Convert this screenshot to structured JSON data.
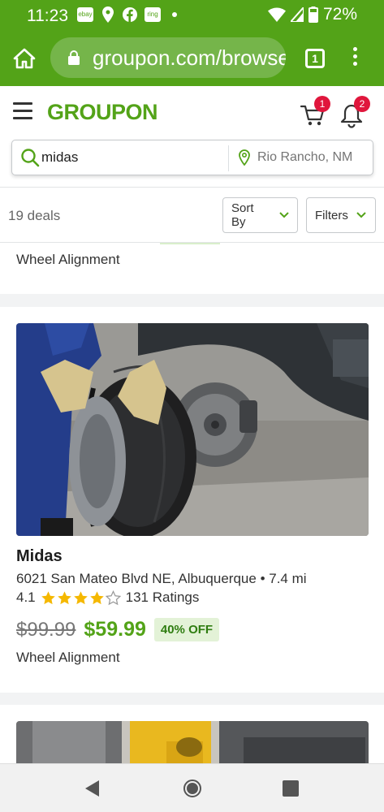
{
  "status_bar": {
    "time": "11:23",
    "notif_icons": [
      "ebay",
      "maps-pin",
      "facebook",
      "ring"
    ],
    "notif_labels": {
      "ebay": "ebay",
      "ring": "ring"
    },
    "battery": "72%",
    "accent": "#53a318"
  },
  "browser": {
    "url": "groupon.com/browse",
    "tab_count": "1"
  },
  "header": {
    "logo": "GROUPON",
    "cart_badge": "1",
    "notification_badge": "2",
    "brand_color": "#53a318",
    "badge_color": "#e0163c"
  },
  "search": {
    "query": "midas",
    "location_placeholder": "Rio Rancho, NM"
  },
  "filters": {
    "deal_count": "19 deals",
    "sort_label": "Sort By",
    "filters_label": "Filters"
  },
  "previous_card": {
    "title": "Wheel Alignment"
  },
  "deal": {
    "merchant": "Midas",
    "address": "6021 San Mateo Blvd NE, Albuquerque",
    "distance": "7.4 mi",
    "rating": "4.1",
    "rating_stars": 4,
    "ratings_count": "131 Ratings",
    "original_price": "$99.99",
    "sale_price": "$59.99",
    "discount": "40% OFF",
    "title": "Wheel Alignment"
  },
  "nav": {
    "back": "back-icon",
    "home": "home-icon",
    "recents": "recents-icon"
  }
}
